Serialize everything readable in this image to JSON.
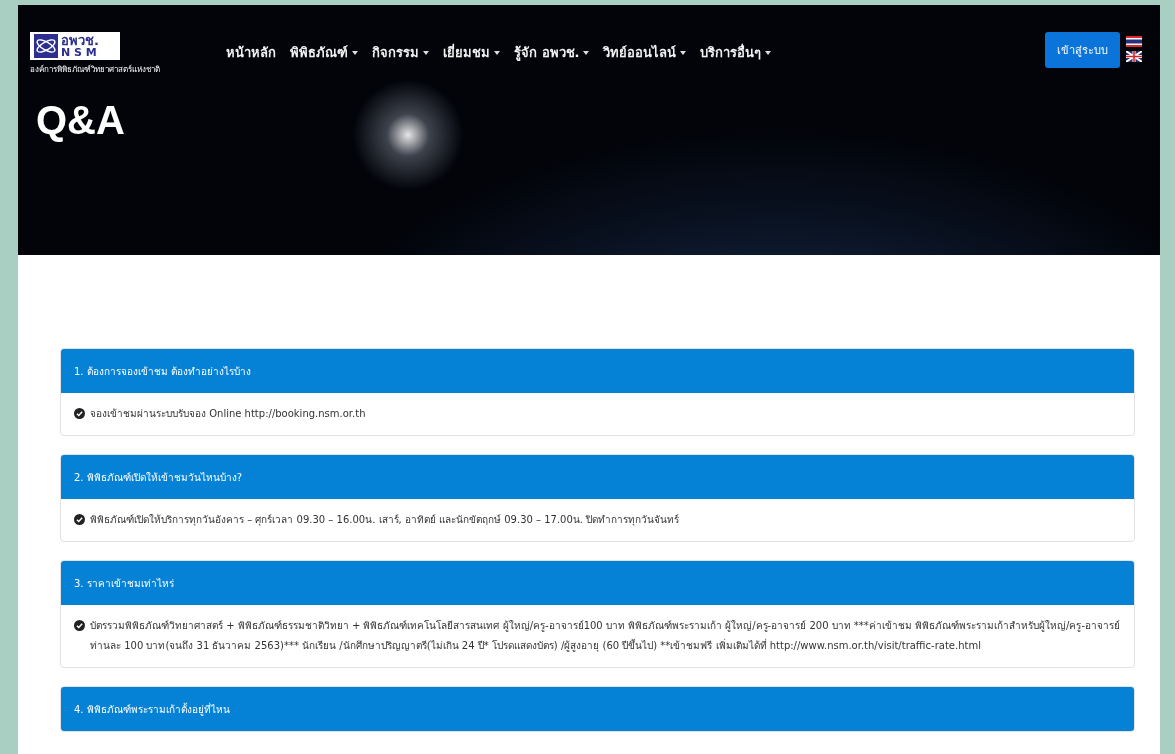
{
  "header": {
    "logo": {
      "abbr": "อพวช.",
      "letters": "N S M",
      "org_name": "องค์การพิพิธภัณฑ์วิทยาศาสตร์แห่งชาติ"
    },
    "nav": [
      {
        "label": "หน้าหลัก",
        "dropdown": false
      },
      {
        "label": "พิพิธภัณฑ์",
        "dropdown": true
      },
      {
        "label": "กิจกรรม",
        "dropdown": true
      },
      {
        "label": "เยี่ยมชม",
        "dropdown": true
      },
      {
        "label": "รู้จัก อพวช.",
        "dropdown": true
      },
      {
        "label": "วิทย์ออนไลน์",
        "dropdown": true
      },
      {
        "label": "บริการอื่นๆ",
        "dropdown": true
      }
    ],
    "login_button": "เข้าสู่ระบบ",
    "page_title": "Q&A"
  },
  "faq": [
    {
      "question": "1. ต้องการจองเข้าชม ต้องทำอย่างไรบ้าง",
      "answer": "จองเข้าชมผ่านระบบรับจอง Online http://booking.nsm.or.th"
    },
    {
      "question": "2. พิพิธภัณฑ์เปิดให้เข้าชมวันไหนบ้าง?",
      "answer": "พิพิธภัณฑ์เปิดให้บริการทุกวันอังคาร – ศุกร์เวลา 09.30 – 16.00น. เสาร์, อาทิตย์ และนักขัตฤกษ์ 09.30 – 17.00น. ปิดทำการทุกวันจันทร์"
    },
    {
      "question": "3. ราคาเข้าชมเท่าไหร่",
      "answer": "บัตรรวมพิพิธภัณฑ์วิทยาศาสตร์ + พิพิธภัณฑ์ธรรมชาติวิทยา + พิพิธภัณฑ์เทคโนโลยีสารสนเทศ ผู้ใหญ่/ครู-อาจารย์100 บาท พิพิธภัณฑ์พระรามเก้า ผู้ใหญ่/ครู-อาจารย์ 200 บาท ***ค่าเข้าชม พิพิธภัณฑ์พระรามเก้าสำหรับผู้ใหญ่/ครู-อาจารย์ ท่านละ 100 บาท(จนถึง 31 ธันวาคม 2563)*** นักเรียน /นักศึกษาปริญญาตรี(ไม่เกิน 24 ปี* โปรดแสดงบัตร) /ผู้สูงอายุ (60 ปีขึ้นไป) **เข้าชมฟรี เพิ่มเติมได้ที่ http://www.nsm.or.th/visit/traffic-rate.html"
    },
    {
      "question": "4. พิพิธภัณฑ์พระรามเก้าตั้งอยู่ที่ไหน"
    }
  ]
}
